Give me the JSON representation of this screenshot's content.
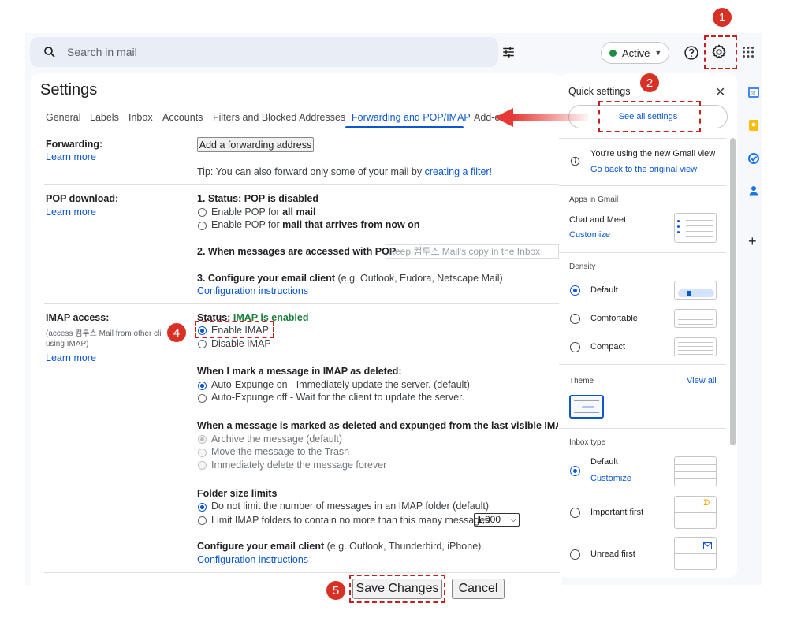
{
  "header": {
    "search_placeholder": "Search in mail",
    "status_label": "Active"
  },
  "badges": [
    "1",
    "2",
    "4",
    "5"
  ],
  "settings": {
    "title": "Settings",
    "tabs": [
      "General",
      "Labels",
      "Inbox",
      "Accounts",
      "Filters and Blocked Addresses",
      "Forwarding and POP/IMAP",
      "Add-o"
    ],
    "forwarding": {
      "label": "Forwarding:",
      "learn_more": "Learn more",
      "add_button": "Add a forwarding address",
      "tip": "Tip: You can also forward only some of your mail by ",
      "tip_link": "creating a filter!"
    },
    "pop": {
      "label": "POP download:",
      "learn_more": "Learn more",
      "status": "1. Status: POP is disabled",
      "opt1_a": "Enable POP for ",
      "opt1_b": "all mail",
      "opt2_a": "Enable POP for ",
      "opt2_b": "mail that arrives from now on",
      "when_accessed": "2. When messages are accessed with POP",
      "when_accessed_value": "keep 컴투스 Mail's copy in the Inbox",
      "configure": "3. Configure your email client",
      "configure_hint": " (e.g. Outlook, Eudora, Netscape Mail)",
      "config_link": "Configuration instructions"
    },
    "imap": {
      "label": "IMAP access:",
      "sub1": "(access 컴투스 Mail from other cli",
      "sub2": "using IMAP)",
      "learn_more": "Learn more",
      "status_prefix": "Status: ",
      "status_value": "IMAP is enabled",
      "enable": "Enable IMAP",
      "disable": "Disable IMAP",
      "deleted_head": "When I mark a message in IMAP as deleted:",
      "expunge_on": "Auto-Expunge on - Immediately update the server. (default)",
      "expunge_off": "Auto-Expunge off - Wait for the client to update the server.",
      "expunged_head": "When a message is marked as deleted and expunged from the last visible IMAP fo",
      "archive": "Archive the message (default)",
      "trash": "Move the message to the Trash",
      "delete_forever": "Immediately delete the message forever",
      "folder_head": "Folder size limits",
      "no_limit": "Do not limit the number of messages in an IMAP folder (default)",
      "limit": "Limit IMAP folders to contain no more than this many messages",
      "limit_value": "1,000",
      "client_head": "Configure your email client",
      "client_hint": " (e.g. Outlook, Thunderbird, iPhone)",
      "client_link": "Configuration instructions"
    },
    "save_label": "Save Changes",
    "cancel_label": "Cancel"
  },
  "quick": {
    "title": "Quick settings",
    "see_all": "See all settings",
    "new_view": "You're using the new Gmail view",
    "go_back": "Go back to the original view",
    "apps_section": "Apps in Gmail",
    "chat_meet": "Chat and Meet",
    "customize": "Customize",
    "density_section": "Density",
    "density_default": "Default",
    "density_comfortable": "Comfortable",
    "density_compact": "Compact",
    "theme_section": "Theme",
    "view_all": "View all",
    "inbox_section": "Inbox type",
    "inbox_default": "Default",
    "inbox_customize": "Customize",
    "important_first": "Important first",
    "unread_first": "Unread first"
  },
  "colors": {
    "accent": "#0b57d0",
    "annotation": "#d93025",
    "imap_green": "#188038"
  }
}
